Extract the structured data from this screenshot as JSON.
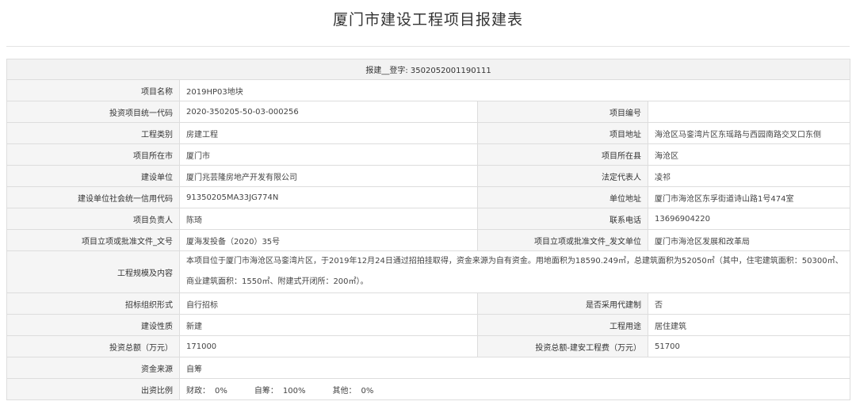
{
  "page_title": "厦门市建设工程项目报建表",
  "header_row": "报建__登字: 3502052001190111",
  "rows": {
    "project_name": {
      "label": "项目名称",
      "value": "2019HP03地块"
    },
    "invest_code": {
      "label": "投资项目统一代码",
      "value": "2020-350205-50-03-000256"
    },
    "project_no": {
      "label": "项目编号",
      "value": ""
    },
    "eng_type": {
      "label": "工程类别",
      "value": "房建工程"
    },
    "address": {
      "label": "项目地址",
      "value": "海沧区马銮湾片区东瑶路与西园南路交叉口东侧"
    },
    "city": {
      "label": "项目所在市",
      "value": "厦门市"
    },
    "county": {
      "label": "项目所在县",
      "value": "海沧区"
    },
    "builder": {
      "label": "建设单位",
      "value": "厦门兆芸隆房地产开发有限公司"
    },
    "legal_rep": {
      "label": "法定代表人",
      "value": "凌祁"
    },
    "credit_code": {
      "label": "建设单位社会统一信用代码",
      "value": "91350205MA33JG774N"
    },
    "unit_address": {
      "label": "单位地址",
      "value": "厦门市海沧区东孚街道诗山路1号474室"
    },
    "manager": {
      "label": "项目负责人",
      "value": "陈琦"
    },
    "phone": {
      "label": "联系电话",
      "value": "13696904220"
    },
    "approval_doc": {
      "label": "项目立项或批准文件_文号",
      "value": "厦海发投备（2020）35号"
    },
    "approval_unit": {
      "label": "项目立项或批准文件_发文单位",
      "value": "厦门市海沧区发展和改革局"
    },
    "scale": {
      "label": "工程规模及内容",
      "value": "本项目位于厦门市海沧区马銮湾片区，于2019年12月24日通过招拍挂取得，资金来源为自有资金。用地面积为18590.249㎡，总建筑面积为52050㎡（其中，住宅建筑面积：50300㎡、商业建筑面积：1550㎡、附建式开闭所：200㎡）。"
    },
    "tender": {
      "label": "招标组织形式",
      "value": "自行招标"
    },
    "agent": {
      "label": "是否采用代建制",
      "value": "否"
    },
    "nature": {
      "label": "建设性质",
      "value": "新建"
    },
    "usage": {
      "label": "工程用途",
      "value": "居住建筑"
    },
    "total_invest": {
      "label": "投资总额（万元）",
      "value": "171000"
    },
    "install_cost": {
      "label": "投资总额-建安工程费（万元）",
      "value": "51700"
    },
    "fund_source": {
      "label": "资金来源",
      "value": "自筹"
    },
    "ratio": {
      "label": "出资比例",
      "finance_label": "财政：",
      "finance_value": "0%",
      "self_label": "自筹：",
      "self_value": "100%",
      "other_label": "其他：",
      "other_value": "0%"
    }
  }
}
